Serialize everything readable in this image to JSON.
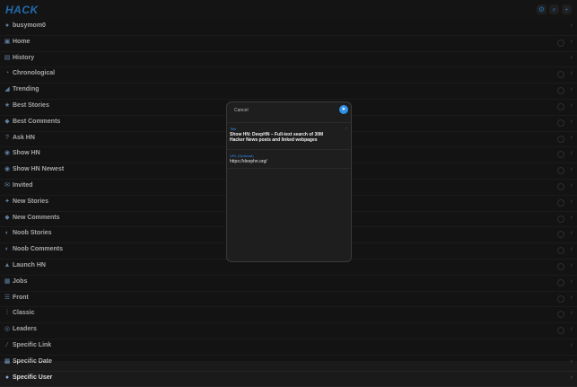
{
  "app": {
    "logo": "HACK",
    "top_icons": [
      {
        "name": "settings-icon",
        "glyph": "⚙"
      },
      {
        "name": "search-icon",
        "glyph": "⌕"
      },
      {
        "name": "add-icon",
        "glyph": "+"
      }
    ]
  },
  "menu": [
    {
      "label": "busymom0",
      "icon": "user-icon",
      "glyph": "●",
      "has_circle": false
    },
    {
      "label": "Home",
      "icon": "home-icon",
      "glyph": "▣",
      "has_circle": true
    },
    {
      "label": "History",
      "icon": "history-icon",
      "glyph": "▤",
      "has_circle": false
    },
    {
      "label": "Chronological",
      "icon": "clock-icon",
      "glyph": "◔",
      "has_circle": true
    },
    {
      "label": "Trending",
      "icon": "trending-icon",
      "glyph": "◢",
      "has_circle": true
    },
    {
      "label": "Best Stories",
      "icon": "award-icon",
      "glyph": "★",
      "has_circle": true
    },
    {
      "label": "Best Comments",
      "icon": "comment-icon",
      "glyph": "◆",
      "has_circle": true
    },
    {
      "label": "Ask HN",
      "icon": "question-icon",
      "glyph": "?",
      "has_circle": true
    },
    {
      "label": "Show HN",
      "icon": "show-icon",
      "glyph": "◉",
      "has_circle": true
    },
    {
      "label": "Show HN Newest",
      "icon": "show-newest-icon",
      "glyph": "◉",
      "has_circle": true
    },
    {
      "label": "Invited",
      "icon": "invite-icon",
      "glyph": "✉",
      "has_circle": true
    },
    {
      "label": "New Stories",
      "icon": "new-stories-icon",
      "glyph": "✦",
      "has_circle": true
    },
    {
      "label": "New Comments",
      "icon": "new-comments-icon",
      "glyph": "◆",
      "has_circle": true
    },
    {
      "label": "Noob Stories",
      "icon": "noob-stories-icon",
      "glyph": "◐",
      "has_circle": true
    },
    {
      "label": "Noob Comments",
      "icon": "noob-comments-icon",
      "glyph": "◐",
      "has_circle": true
    },
    {
      "label": "Launch HN",
      "icon": "rocket-icon",
      "glyph": "▲",
      "has_circle": true
    },
    {
      "label": "Jobs",
      "icon": "briefcase-icon",
      "glyph": "▦",
      "has_circle": true
    },
    {
      "label": "Front",
      "icon": "front-icon",
      "glyph": "☰",
      "has_circle": true
    },
    {
      "label": "Classic",
      "icon": "classic-icon",
      "glyph": "⁞",
      "has_circle": true
    },
    {
      "label": "Leaders",
      "icon": "eye-icon",
      "glyph": "◎",
      "has_circle": true
    },
    {
      "label": "Specific Link",
      "icon": "link-icon",
      "glyph": "⁄",
      "has_circle": false
    },
    {
      "label": "Specific Date",
      "icon": "calendar-icon",
      "glyph": "▦",
      "has_circle": false
    },
    {
      "label": "Specific User",
      "icon": "user-search-icon",
      "glyph": "●",
      "has_circle": false
    }
  ],
  "modal": {
    "cancel_label": "Cancel",
    "title_label": "Title",
    "title_value": "Show HN: DeepHN – Full-text search of 30M Hacker News posts and linked webpages",
    "url_label": "URL (Optional)",
    "url_value": "https://deephn.org/"
  },
  "colors": {
    "accent": "#2f8fe8",
    "background": "#1a1a1a"
  }
}
